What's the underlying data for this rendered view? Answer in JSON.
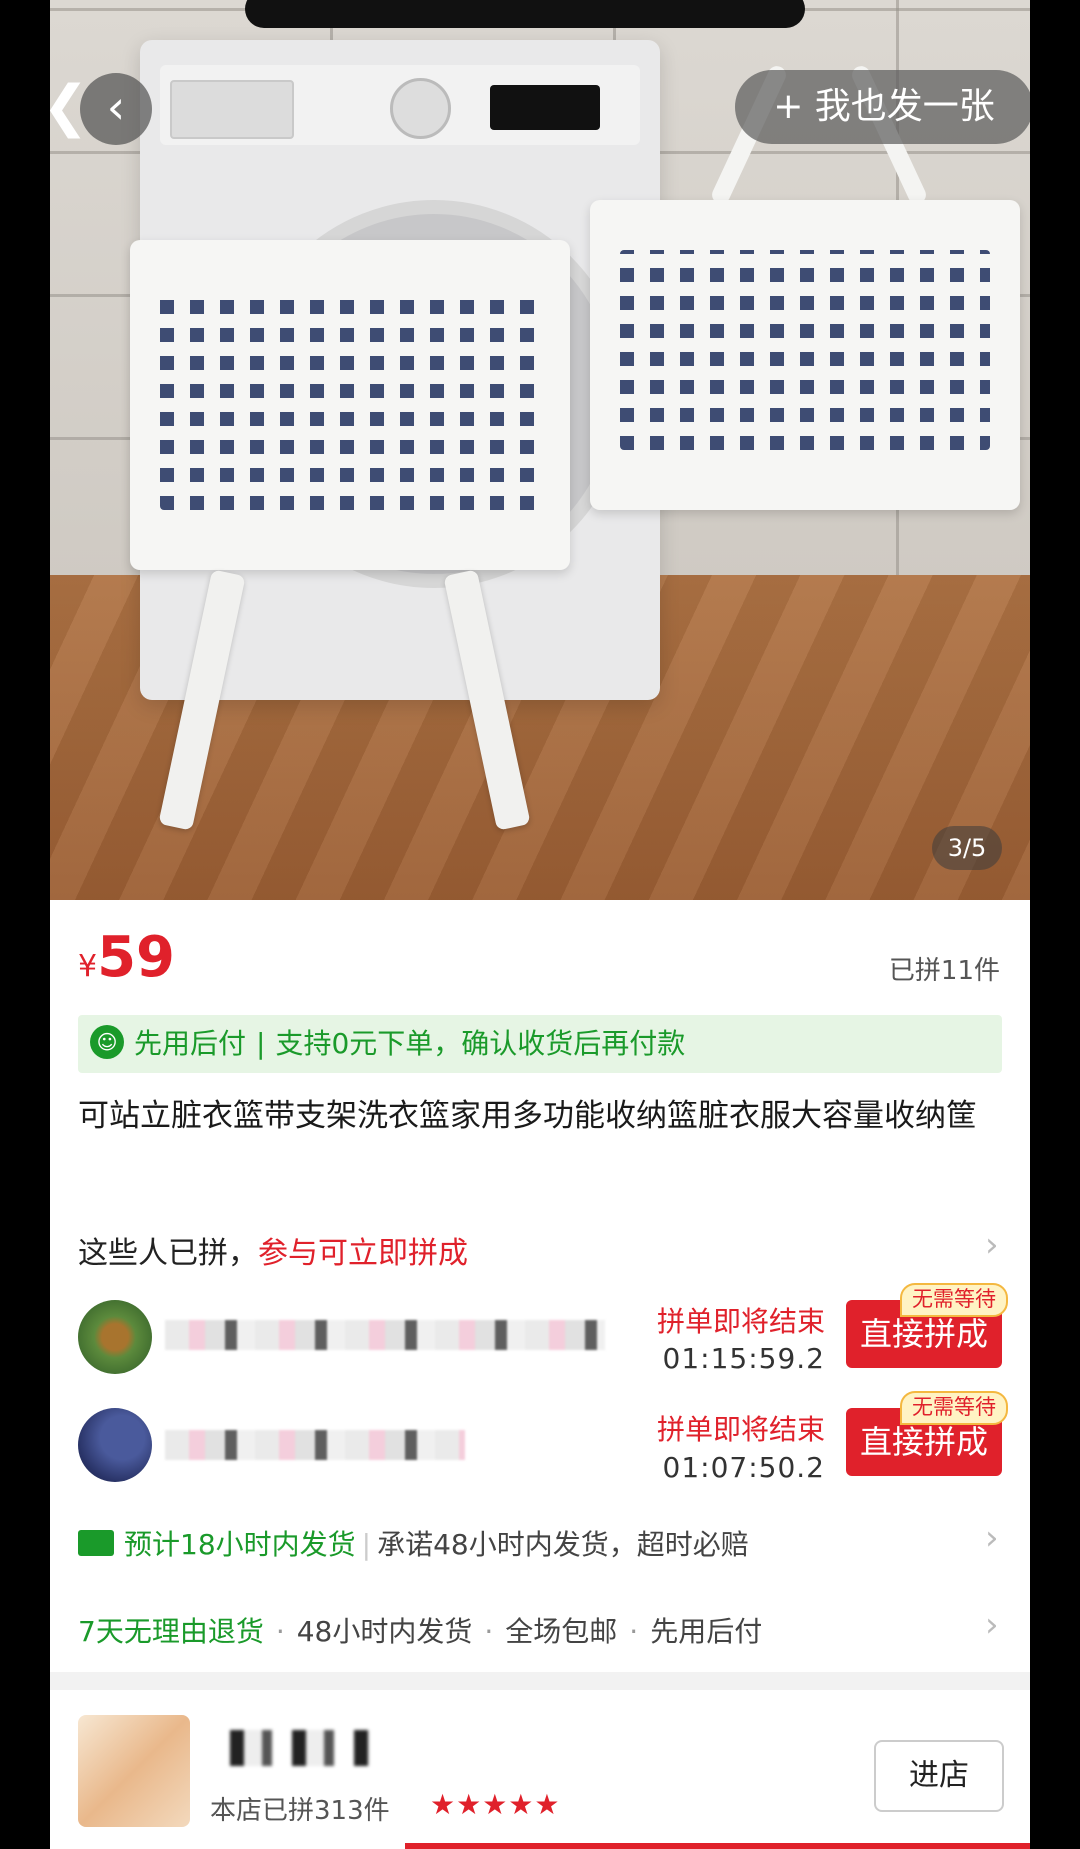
{
  "gallery": {
    "post_button_label": "+ 我也发一张",
    "counter": "3/5",
    "back_glyph": "❮"
  },
  "product": {
    "currency_symbol": "¥",
    "price": "59",
    "sold_count": "已拼11件",
    "pay_later_label": "先用后付",
    "pay_later_sep": "|",
    "pay_later_desc": "支持0元下单，确认收货后再付款",
    "title": "可站立脏衣篮带支架洗衣篮家用多功能收纳篮脏衣服大容量收纳筐"
  },
  "group_buy": {
    "heading": "这些人已拼，",
    "heading_highlight": "参与可立即拼成",
    "rows": [
      {
        "status": "拼单即将结束",
        "timer": "01:15:59.2",
        "button": "直接拼成",
        "tag": "无需等待"
      },
      {
        "status": "拼单即将结束",
        "timer": "01:07:50.2",
        "button": "直接拼成",
        "tag": "无需等待"
      }
    ]
  },
  "shipping": {
    "estimate": "预计18小时内发货",
    "separator": "|",
    "promise": "承诺48小时内发货，超时必赔"
  },
  "services": {
    "items": [
      "7天无理由退货",
      "48小时内发货",
      "全场包邮",
      "先用后付"
    ],
    "dot": "·"
  },
  "shop": {
    "sales": "本店已拼313件",
    "rating_stars": "★★★★★",
    "enter_label": "进店"
  },
  "colors": {
    "accent_red": "#e0212b",
    "green": "#1a9a2a"
  }
}
